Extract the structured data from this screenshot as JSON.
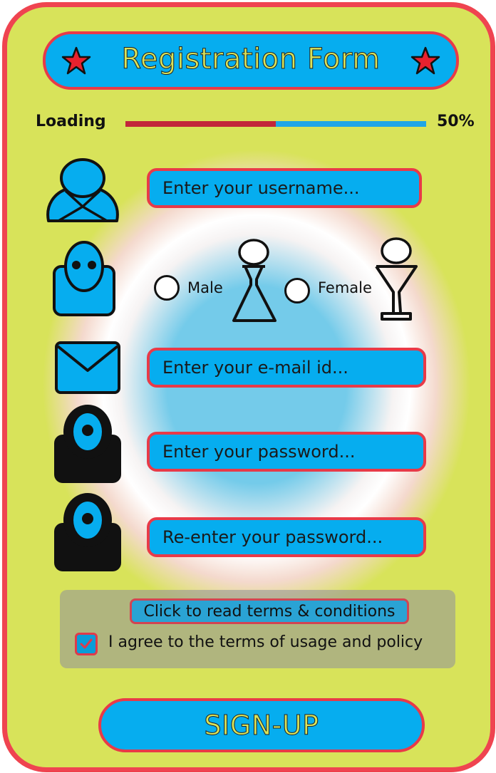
{
  "header": {
    "title": "Registration Form",
    "left_icon": "star-icon",
    "right_icon": "star-icon"
  },
  "loading": {
    "label": "Loading",
    "percent_text": "50%",
    "progress": 0.5
  },
  "form": {
    "username_placeholder": "Enter your username...",
    "gender": {
      "options": [
        "Male",
        "Female"
      ],
      "selected": null
    },
    "email_placeholder": "Enter your e-mail id...",
    "password_placeholder": "Enter your password...",
    "confirm_password_placeholder": "Re-enter your password..."
  },
  "terms": {
    "link_label": "Click to read terms & conditions",
    "agree_label": "I agree to the terms of usage and policy",
    "agree_checked": true
  },
  "submit": {
    "label": "SIGN-UP"
  },
  "colors": {
    "frame": "#ef4450",
    "background": "#d8e35a",
    "field": "#06adef",
    "field_border": "#e83a48",
    "title_text": "#d8e35a"
  },
  "icons": [
    "star-icon",
    "user-icon",
    "gender-icon",
    "male-figure-icon",
    "female-figure-icon",
    "mail-icon",
    "lock-icon"
  ]
}
